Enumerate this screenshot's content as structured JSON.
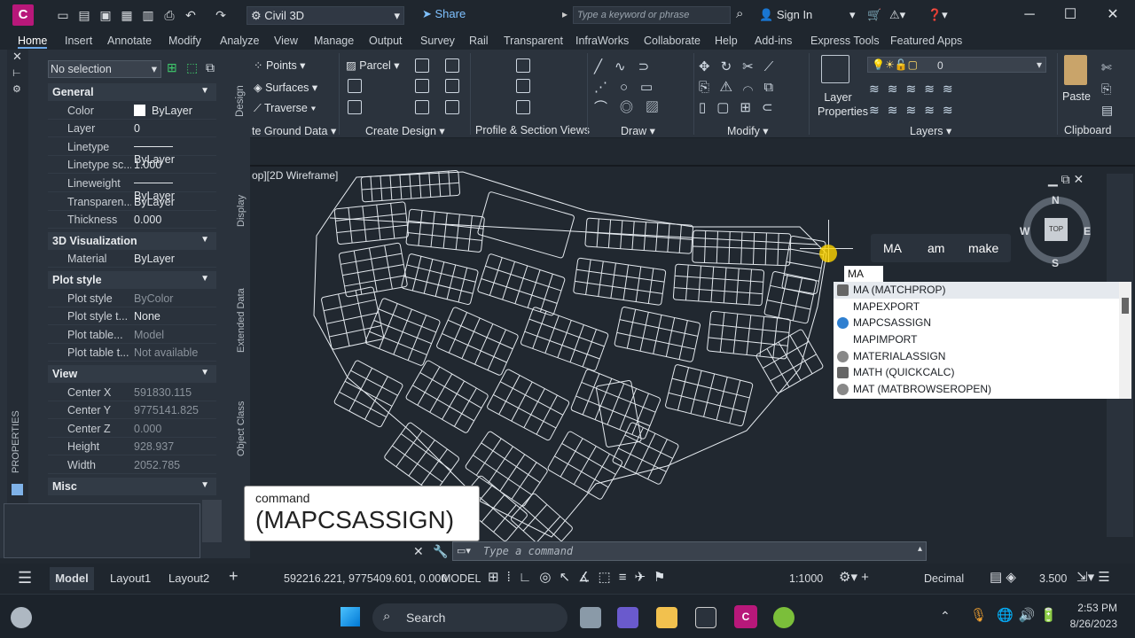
{
  "titlebar": {
    "app_icon": "C",
    "workspace": "Civil 3D",
    "share": "Share",
    "search_placeholder": "Type a keyword or phrase",
    "sign_in": "Sign In"
  },
  "tabs": [
    "Home",
    "Insert",
    "Annotate",
    "Modify",
    "Analyze",
    "View",
    "Manage",
    "Output",
    "Survey",
    "Rail",
    "Transparent",
    "InfraWorks",
    "Collaborate",
    "Help",
    "Add-ins",
    "Express Tools",
    "Featured Apps"
  ],
  "ribbon": {
    "points": "Points",
    "surfaces": "Surfaces",
    "traverse": "Traverse",
    "parcel": "Parcel",
    "layer_value": "0",
    "layer_properties": "Layer Properties",
    "paste": "Paste",
    "panels": {
      "ground_data": "te Ground Data",
      "create_design": "Create Design",
      "profile": "Profile & Section Views",
      "draw": "Draw",
      "modify": "Modify",
      "layers": "Layers",
      "clipboard": "Clipboard"
    }
  },
  "properties": {
    "selection": "No selection",
    "vertical_label": "PROPERTIES",
    "sections": {
      "general": "General",
      "viz": "3D Visualization",
      "plot": "Plot style",
      "view": "View",
      "misc": "Misc"
    },
    "general": [
      {
        "k": "Color",
        "v": "ByLayer"
      },
      {
        "k": "Layer",
        "v": "0"
      },
      {
        "k": "Linetype",
        "v": "ByLayer"
      },
      {
        "k": "Linetype sc...",
        "v": "1.000"
      },
      {
        "k": "Lineweight",
        "v": "ByLayer"
      },
      {
        "k": "Transparen...",
        "v": "ByLayer"
      },
      {
        "k": "Thickness",
        "v": "0.000"
      }
    ],
    "viz": [
      {
        "k": "Material",
        "v": "ByLayer"
      }
    ],
    "plot": [
      {
        "k": "Plot style",
        "v": "ByColor"
      },
      {
        "k": "Plot style t...",
        "v": "None"
      },
      {
        "k": "Plot table...",
        "v": "Model"
      },
      {
        "k": "Plot table t...",
        "v": "Not available"
      }
    ],
    "view": [
      {
        "k": "Center X",
        "v": "591830.115"
      },
      {
        "k": "Center Y",
        "v": "9775141.825"
      },
      {
        "k": "Center Z",
        "v": "0.000"
      },
      {
        "k": "Height",
        "v": "928.937"
      },
      {
        "k": "Width",
        "v": "2052.785"
      }
    ],
    "side_tabs": [
      "Design",
      "Display",
      "Extended Data",
      "Object Class"
    ]
  },
  "viewport": {
    "label": "op][2D Wireframe]",
    "compass": {
      "n": "N",
      "s": "S",
      "e": "E",
      "w": "W",
      "top": "TOP"
    },
    "suggestions": [
      "MA",
      "am",
      "make"
    ],
    "typed": "MA"
  },
  "autocomplete": [
    {
      "label": "MA (MATCHPROP)",
      "icon": "tool"
    },
    {
      "label": "MAPEXPORT",
      "icon": "none"
    },
    {
      "label": "MAPCSASSIGN",
      "icon": "globe"
    },
    {
      "label": "MAPIMPORT",
      "icon": "none"
    },
    {
      "label": "MATERIALASSIGN",
      "icon": "material"
    },
    {
      "label": "MATH (QUICKCALC)",
      "icon": "calc"
    },
    {
      "label": "MAT (MATBROWSEROPEN)",
      "icon": "material"
    }
  ],
  "tooltip": {
    "caption": "command",
    "command": "(MAPCSASSIGN)"
  },
  "command_placeholder": "Type a command",
  "statusbar": {
    "model_tab": "Model",
    "layout1": "Layout1",
    "layout2": "Layout2",
    "coords": "592216.221, 9775409.601, 0.000",
    "mode": "MODEL",
    "scale": "1:1000",
    "units": "Decimal",
    "value": "3.500"
  },
  "taskbar": {
    "search": "Search",
    "time": "2:53 PM",
    "date": "8/26/2023"
  },
  "colors": {
    "accent": "#1a7be0",
    "brand": "#b8187a"
  }
}
